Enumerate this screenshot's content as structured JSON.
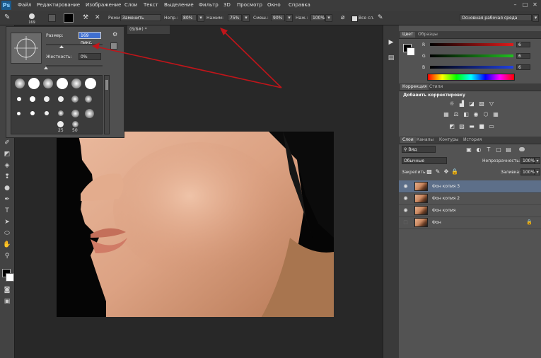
{
  "app": {
    "logo_text": "Ps"
  },
  "menu": [
    "Файл",
    "Редактирование",
    "Изображение",
    "Слои",
    "Текст",
    "Выделение",
    "Фильтр",
    "3D",
    "Просмотр",
    "Окно",
    "Справка"
  ],
  "window_controls": [
    "–",
    "□",
    "✕"
  ],
  "options_bar": {
    "brush_size": "169",
    "mode_label": "Режим:",
    "mode_value": "Заменить",
    "opacity_label": "Непр.:",
    "opacity_value": "80%",
    "flow_label": "Нажим:",
    "flow_value": "75%",
    "mix_label": "Смеш.:",
    "mix_value": "90%",
    "pressure_label": "Наж.:",
    "pressure_value": "100%",
    "all_layers_label": "Все сл.",
    "workspace": "Основная рабочая среда"
  },
  "document": {
    "tab_title": "(B/8#) *"
  },
  "brush_panel": {
    "size_label": "Размер:",
    "size_value": "169 пикс.",
    "hardness_label": "Жесткость:",
    "hardness_value": "0%",
    "size_level": 0.28,
    "hardness_level": 0.0,
    "preset_numbers": [
      "25",
      "50"
    ]
  },
  "color_panel": {
    "tabs": [
      "Цвет",
      "Образцы"
    ],
    "rows": [
      {
        "label": "R",
        "value": "6"
      },
      {
        "label": "G",
        "value": "6"
      },
      {
        "label": "B",
        "value": "6"
      }
    ]
  },
  "adjustments_panel": {
    "tabs": [
      "Коррекция",
      "Стили"
    ],
    "title": "Добавить корректировку"
  },
  "layers_panel": {
    "tabs": [
      "Слои",
      "Каналы",
      "Контуры",
      "История"
    ],
    "filter_label": "Вид",
    "blend_mode": "Обычные",
    "opacity_label": "Непрозрачность:",
    "opacity_value": "100%",
    "lock_label": "Закрепить:",
    "fill_label": "Заливка:",
    "fill_value": "100%",
    "layers": [
      {
        "name": "Фон копия 3",
        "selected": true,
        "visible": true
      },
      {
        "name": "Фон копия 2",
        "selected": false,
        "visible": true
      },
      {
        "name": "Фон копия",
        "selected": false,
        "visible": true
      },
      {
        "name": "Фон",
        "selected": false,
        "visible": false,
        "locked": true
      }
    ]
  },
  "colors": {
    "accent_selection": "#5d6f89",
    "annotation_arrow": "#c0151a"
  }
}
